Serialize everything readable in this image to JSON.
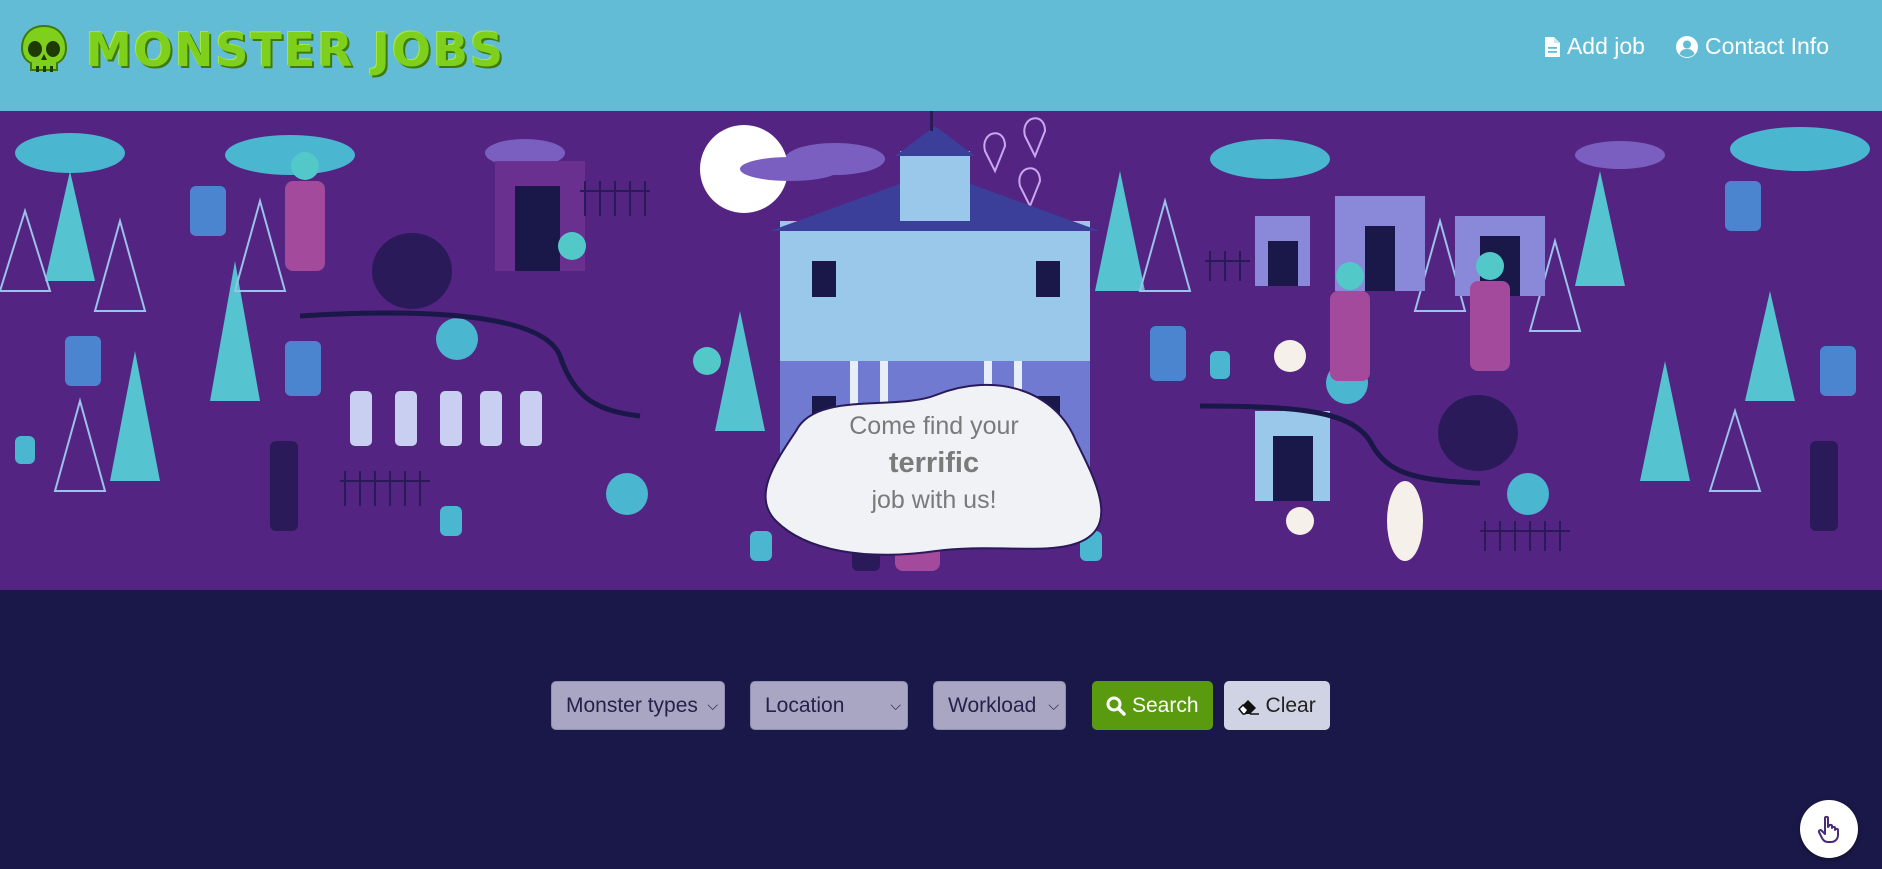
{
  "header": {
    "logo_text": "MONSTER JOBS",
    "nav": [
      {
        "label": "Add job",
        "icon": "file-icon"
      },
      {
        "label": "Contact Info",
        "icon": "user-circle-icon"
      }
    ]
  },
  "hero": {
    "bubble_line1": "Come find your",
    "bubble_line2": "terrific",
    "bubble_line3": "job with us!"
  },
  "filters": {
    "monster_types": "Monster types",
    "location": "Location",
    "workload": "Workload",
    "search_label": "Search",
    "clear_label": "Clear"
  },
  "colors": {
    "header_bg": "#63bcd5",
    "banner_bg": "#532482",
    "page_bg": "#1a1848",
    "logo_green": "#7fcf1d",
    "search_green": "#5a9a0f"
  },
  "fab": {
    "icon": "hand-pointer-icon"
  }
}
